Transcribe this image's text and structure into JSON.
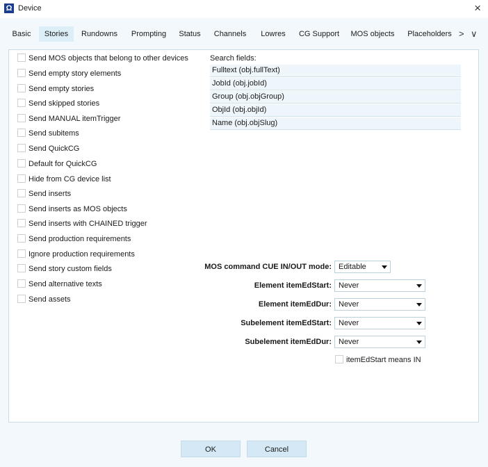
{
  "window": {
    "title": "Device",
    "app_icon_glyph": "Ω",
    "app_icon": "omega-app-icon",
    "close_glyph": "×"
  },
  "tabs": [
    {
      "label": "Basic",
      "active": false
    },
    {
      "label": "Stories",
      "active": true
    },
    {
      "label": "Rundowns",
      "active": false
    },
    {
      "label": "Prompting",
      "active": false
    },
    {
      "label": "Status",
      "active": false
    },
    {
      "label": "Channels",
      "active": false
    },
    {
      "label": "Lowres",
      "active": false
    },
    {
      "label": "CG Support",
      "active": false
    },
    {
      "label": "MOS objects",
      "active": false
    },
    {
      "label": "Placeholders",
      "active": false
    }
  ],
  "tab_nav": {
    "next_glyph": ">",
    "overflow_glyph": "∨"
  },
  "options": [
    {
      "label": "Send MOS objects that belong to other devices",
      "checked": false
    },
    {
      "label": "Send empty story elements",
      "checked": false
    },
    {
      "label": "Send empty stories",
      "checked": false
    },
    {
      "label": "Send skipped stories",
      "checked": false
    },
    {
      "label": "Send MANUAL itemTrigger",
      "checked": false
    },
    {
      "label": "Send subitems",
      "checked": false
    },
    {
      "label": "Send QuickCG",
      "checked": false
    },
    {
      "label": "Default for QuickCG",
      "checked": false
    },
    {
      "label": "Hide from CG device list",
      "checked": false
    },
    {
      "label": "Send inserts",
      "checked": false
    },
    {
      "label": "Send inserts as MOS objects",
      "checked": false
    },
    {
      "label": "Send inserts with CHAINED trigger",
      "checked": false
    },
    {
      "label": "Send production requirements",
      "checked": false
    },
    {
      "label": "Ignore production requirements",
      "checked": false
    },
    {
      "label": "Send story custom fields",
      "checked": false
    },
    {
      "label": "Send alternative texts",
      "checked": false
    },
    {
      "label": "Send assets",
      "checked": false
    }
  ],
  "search_fields": {
    "title": "Search fields:",
    "items": [
      "Fulltext (obj.fullText)",
      "JobId (obj.jobId)",
      "Group (obj.objGroup)",
      "ObjId (obj.objId)",
      "Name (obj.objSlug)"
    ]
  },
  "settings": [
    {
      "label": "MOS command CUE IN/OUT mode:",
      "value": "Editable"
    },
    {
      "label": "Element itemEdStart:",
      "value": "Never"
    },
    {
      "label": "Element itemEdDur:",
      "value": "Never"
    },
    {
      "label": "Subelement itemEdStart:",
      "value": "Never"
    },
    {
      "label": "Subelement itemEdDur:",
      "value": "Never"
    }
  ],
  "itemEdStart_means_in": {
    "label": "itemEdStart means IN",
    "checked": false
  },
  "buttons": {
    "ok": "OK",
    "cancel": "Cancel"
  },
  "colors": {
    "active_tab": "#dceef8",
    "button": "#d4e9f5",
    "background": "#f2f8fb"
  }
}
